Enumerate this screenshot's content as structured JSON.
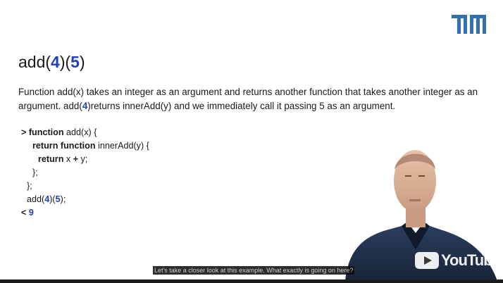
{
  "slide": {
    "logo_text": "TUM",
    "title_prefix": "add(",
    "title_arg1": "4",
    "title_mid": ")(",
    "title_arg2": "5",
    "title_suffix": ")",
    "paragraph": {
      "part1": "Function add(x) takes an integer as an argument and returns another function that takes another integer as an argument. add(",
      "arg": "4",
      "part2": ")returns innerAdd(y) and we immediately call it passing 5 as an argument."
    },
    "code": {
      "l1_prompt": "> ",
      "l1_kw": "function",
      "l1_rest": " add(x) {",
      "l2_kw1": "return",
      "l2_sp": " ",
      "l2_kw2": "function",
      "l2_rest": " innerAdd(y) {",
      "l3_kw": "return",
      "l3_a": " x ",
      "l3_op": "+",
      "l3_b": " y;",
      "l4": "};",
      "l5": "};",
      "l6_a": "add(",
      "l6_n1": "4",
      "l6_b": ")(",
      "l6_n2": "5",
      "l6_c": ");",
      "out_prompt": "< ",
      "out_value": "9"
    }
  },
  "player": {
    "caption": "Let's take a closer look at this example. What exactly is going on here?",
    "watermark": "YouTube",
    "watermark_icon": "youtube-play-icon"
  },
  "colors": {
    "accent_blue": "#1f3fbf",
    "tum_blue": "#3070b3"
  }
}
